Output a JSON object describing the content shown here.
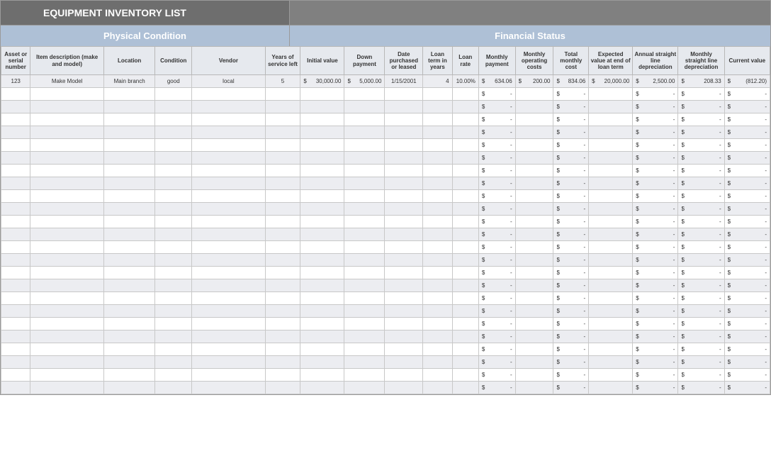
{
  "title": "EQUIPMENT INVENTORY LIST",
  "sections": {
    "left": "Physical Condition",
    "right": "Financial Status"
  },
  "headers": {
    "asset": "Asset or serial number",
    "desc": "Item description (make and model)",
    "loc": "Location",
    "cond": "Condition",
    "vend": "Vendor",
    "yrs": "Years of service left",
    "init": "Initial value",
    "down": "Down payment",
    "date": "Date purchased or leased",
    "lterm": "Loan term in years",
    "lrate": "Loan rate",
    "mpay": "Monthly payment",
    "moc": "Monthly operating costs",
    "tmc": "Total monthly cost",
    "exp": "Expected value at end of loan term",
    "ann": "Annual straight line depreciation",
    "msl": "Monthly straight line depreciation",
    "cur": "Current value"
  },
  "row1": {
    "asset": "123",
    "desc": "Make Model",
    "loc": "Main branch",
    "cond": "good",
    "vend": "local",
    "yrs": "5",
    "init": "30,000.00",
    "down": "5,000.00",
    "date": "1/15/2001",
    "lterm": "4",
    "lrate": "10.00%",
    "mpay": "634.06",
    "moc": "200.00",
    "tmc": "834.06",
    "exp": "20,000.00",
    "ann": "2,500.00",
    "msl": "208.33",
    "cur": "(812.20)"
  },
  "dash": "-",
  "sym": "$",
  "empty_rows": 24
}
